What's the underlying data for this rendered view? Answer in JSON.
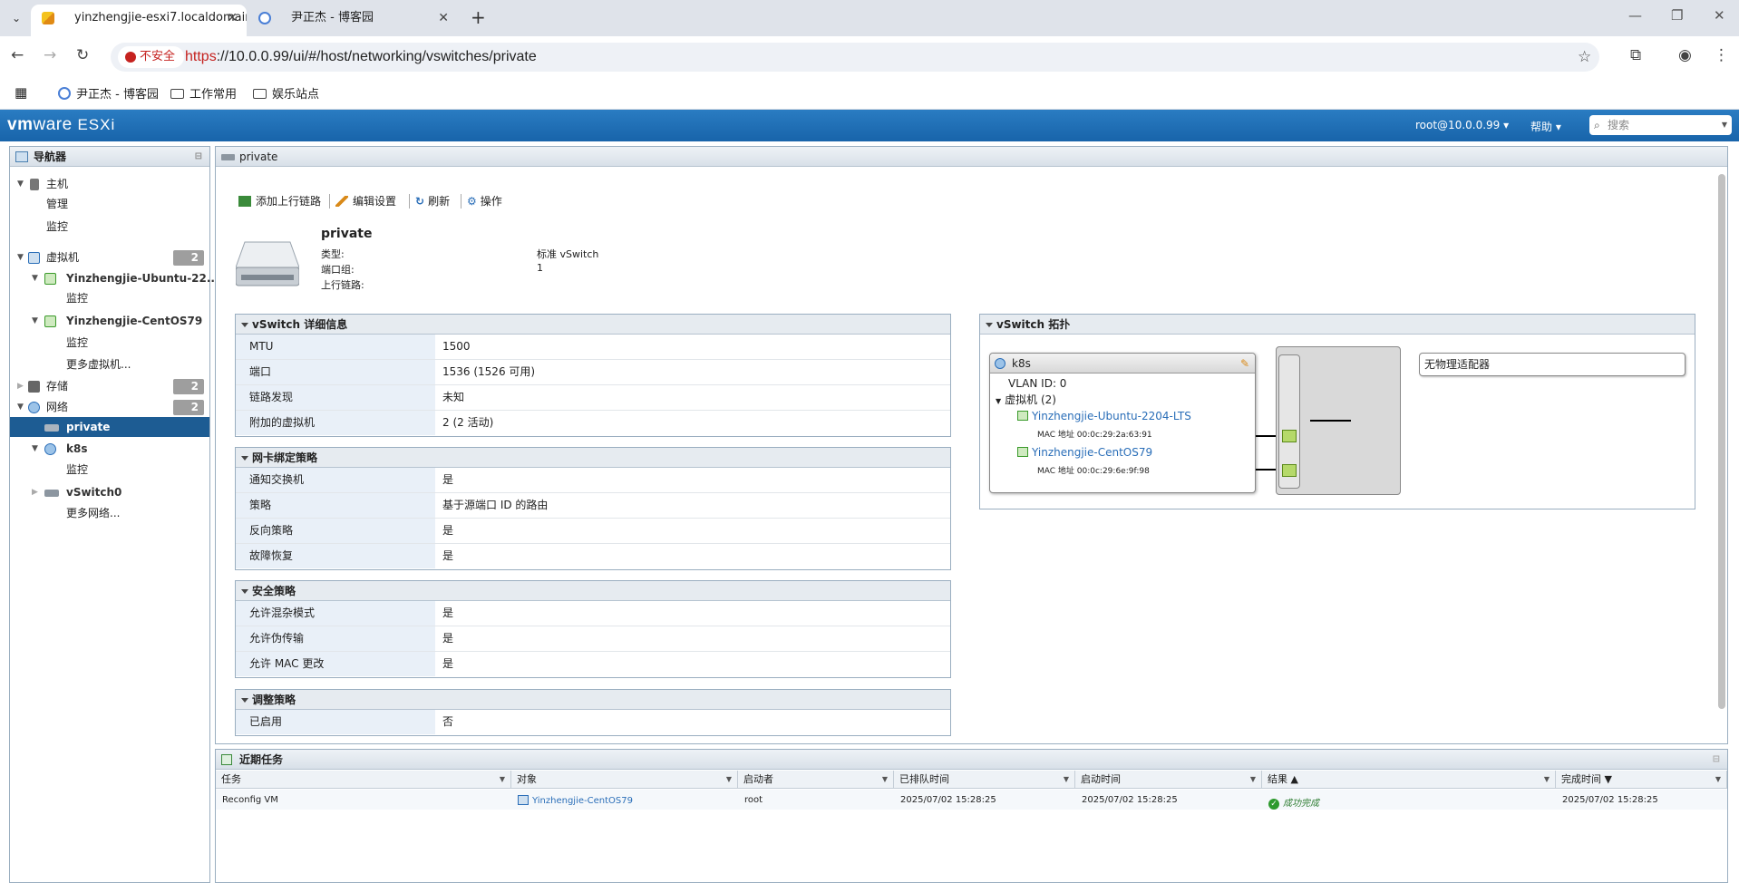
{
  "browser": {
    "tabs": [
      {
        "title": "yinzhengjie-esxi7.localdomain"
      },
      {
        "title": "尹正杰 - 博客园"
      }
    ],
    "security_label": "不安全",
    "url_scheme": "https",
    "url_rest": "://10.0.0.99/ui/#/host/networking/vswitches/private",
    "bookmarks": [
      "尹正杰 - 博客园",
      "工作常用",
      "娱乐站点"
    ]
  },
  "esxi": {
    "logo_vm": "vm",
    "logo_ware": "ware",
    "logo_product": "ESXi",
    "user_menu": "root@10.0.0.99 ▾",
    "help_menu": "帮助 ▾",
    "search_placeholder": "搜索"
  },
  "navigator": {
    "title": "导航器",
    "host": "主机",
    "host_manage": "管理",
    "host_monitor": "监控",
    "vms": "虚拟机",
    "vms_count": "2",
    "vm1": "Yinzhengjie-Ubuntu-22...",
    "vm1_monitor": "监控",
    "vm2": "Yinzhengjie-CentOS79",
    "vm2_monitor": "监控",
    "more_vms": "更多虚拟机...",
    "storage": "存储",
    "storage_count": "2",
    "network": "网络",
    "network_count": "2",
    "private": "private",
    "k8s": "k8s",
    "k8s_monitor": "监控",
    "vswitch0": "vSwitch0",
    "more_networks": "更多网络..."
  },
  "panel": {
    "title": "private",
    "toolbar": {
      "add_uplink": "添加上行链路",
      "edit_settings": "编辑设置",
      "refresh": "刷新",
      "actions": "操作"
    },
    "summary": {
      "name": "private",
      "type_label": "类型:",
      "type_value": "标准 vSwitch",
      "portgroups_label": "端口组:",
      "portgroups_value": "1",
      "uplinks_label": "上行链路:"
    },
    "details": {
      "title": "vSwitch 详细信息",
      "rows": [
        {
          "k": "MTU",
          "v": "1500"
        },
        {
          "k": "端口",
          "v": "1536 (1526 可用)"
        },
        {
          "k": "链路发现",
          "v": "未知"
        },
        {
          "k": "附加的虚拟机",
          "v": "2 (2 活动)"
        }
      ]
    },
    "teaming": {
      "title": "网卡绑定策略",
      "rows": [
        {
          "k": "通知交换机",
          "v": "是"
        },
        {
          "k": "策略",
          "v": "基于源端口 ID 的路由"
        },
        {
          "k": "反向策略",
          "v": "是"
        },
        {
          "k": "故障恢复",
          "v": "是"
        }
      ]
    },
    "security": {
      "title": "安全策略",
      "rows": [
        {
          "k": "允许混杂模式",
          "v": "是"
        },
        {
          "k": "允许伪传输",
          "v": "是"
        },
        {
          "k": "允许 MAC 更改",
          "v": "是"
        }
      ]
    },
    "shaping": {
      "title": "调整策略",
      "rows": [
        {
          "k": "已启用",
          "v": "否"
        }
      ]
    },
    "topology": {
      "title": "vSwitch 拓扑",
      "portgroup": "k8s",
      "vlan": "VLAN ID: 0",
      "vm_group": "虚拟机 (2)",
      "vm1": "Yinzhengjie-Ubuntu-2204-LTS",
      "vm1_mac": "MAC 地址 00:0c:29:2a:63:91",
      "vm2": "Yinzhengjie-CentOS79",
      "vm2_mac": "MAC 地址 00:0c:29:6e:9f:98",
      "no_physical": "无物理适配器"
    }
  },
  "tasks": {
    "title": "近期任务",
    "columns": [
      "任务",
      "对象",
      "启动者",
      "已排队时间",
      "启动时间",
      "结果 ▲",
      "完成时间 ▼"
    ],
    "row": {
      "task": "Reconfig VM",
      "object": "Yinzhengjie-CentOS79",
      "initiator": "root",
      "queued": "2025/07/02 15:28:25",
      "started": "2025/07/02 15:28:25",
      "result": "成功完成",
      "completed": "2025/07/02 15:28:25"
    }
  },
  "colors": {
    "header_blue": "#1864aa",
    "selected": "#1d5c93",
    "link": "#2a6eb8",
    "port_green": "#b5d96a"
  }
}
